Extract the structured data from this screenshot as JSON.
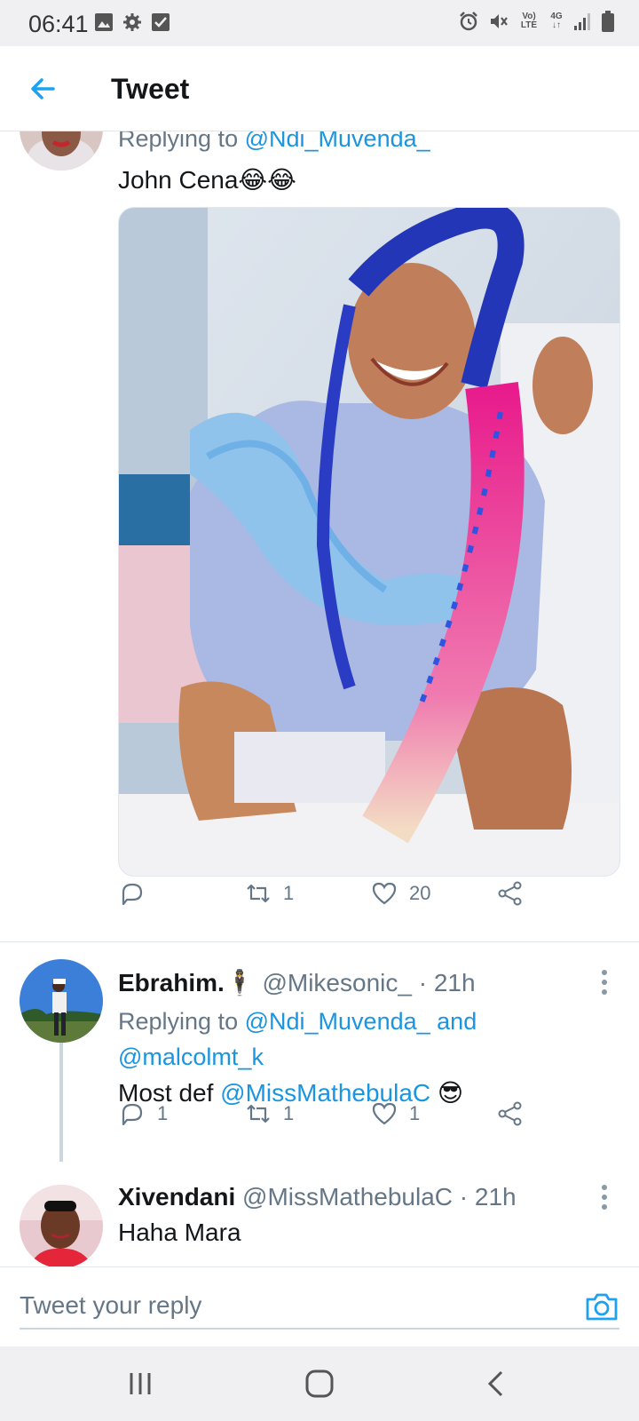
{
  "status_bar": {
    "time": "06:41",
    "left_icons": [
      "image-icon",
      "gear-icon",
      "checkbox-icon"
    ],
    "right_icons": [
      "alarm-icon",
      "mute-icon",
      "volte-icon",
      "4g-icon",
      "signal-icon",
      "battery-icon"
    ],
    "volte_label": "Vo) LTE",
    "network_label": "4G"
  },
  "header": {
    "title": "Tweet",
    "back_icon": "back-arrow-icon",
    "accent": "#1da1f2"
  },
  "tweet1": {
    "reply_prefix": "Replying to",
    "reply_handle": "@Ndi_Muvenda_",
    "text": "John Cena😂😂",
    "media_icon": "photo-woman-braids",
    "actions": {
      "reply_count": "",
      "retweet_count": "1",
      "like_count": "20"
    }
  },
  "tweet2": {
    "name": "Ebrahim.🕴",
    "handle": "@Mikesonic_",
    "time": "· 21h",
    "reply_prefix": "Replying to",
    "reply_handle_1": "@Ndi_Muvenda_",
    "reply_and": "and",
    "reply_handle_2": "@malcolmt_k",
    "text_prefix": "Most def",
    "text_mention": "@MissMathebulaC",
    "text_emoji": "😎",
    "actions": {
      "reply_count": "1",
      "retweet_count": "1",
      "like_count": "1"
    }
  },
  "tweet3": {
    "name": "Xivendani",
    "handle": "@MissMathebulaC",
    "time": "· 21h",
    "text": "Haha Mara"
  },
  "reply_bar": {
    "placeholder": "Tweet your reply",
    "camera_icon": "camera-icon"
  },
  "nav_bar": {
    "icons": [
      "recent-apps-icon",
      "home-icon",
      "back-icon"
    ]
  },
  "colors": {
    "link": "#1b95e0",
    "muted": "#657786",
    "text": "#14171a",
    "divider": "#e1e8ed"
  }
}
